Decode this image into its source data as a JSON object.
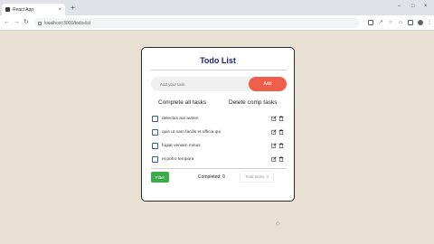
{
  "browser": {
    "tab_title": "React App",
    "tab_close": "×",
    "new_tab": "+",
    "url": "localhost:3000/todo-list",
    "window_controls": [
      "–",
      "□",
      "×"
    ]
  },
  "app": {
    "title": "Todo List",
    "input_placeholder": "Add your task",
    "add_label": "Add",
    "complete_all_label": "Complete all tasks",
    "delete_completed_label": "Delete comp tasks",
    "todos": [
      {
        "text": "delectus aut autem"
      },
      {
        "text": "quis ut nam facilis et officia qui"
      },
      {
        "text": "fugiat veniam minus"
      },
      {
        "text": "et porro tempora"
      }
    ],
    "filter_label": "Filter",
    "completed_label": "Completed: 0",
    "total_label": "Total tasks: 4"
  },
  "colors": {
    "title": "#1d1f6e",
    "add_button": "#ee5e48",
    "filter_button": "#3daa4c",
    "background": "#e8e1d3"
  }
}
